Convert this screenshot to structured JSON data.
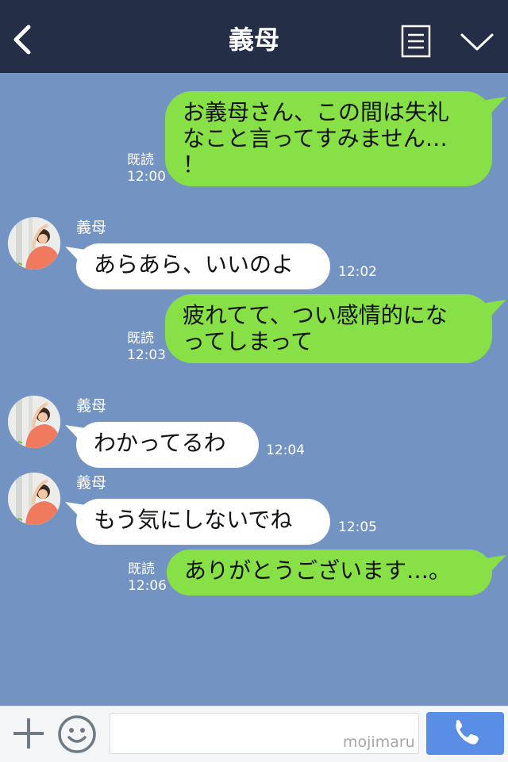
{
  "header": {
    "title": "義母",
    "background": "#242e46"
  },
  "colors": {
    "chat_background": "#7393c3",
    "outgoing_bubble": "#86e046",
    "incoming_bubble": "#ffffff",
    "call_button": "#5a8de6"
  },
  "messages": [
    {
      "direction": "out",
      "text": "お義母さん、この間は失礼\nなこと言ってすみません…\n！",
      "read_label": "既読",
      "time": "12:00"
    },
    {
      "direction": "in",
      "sender": "義母",
      "text": "あらあら、いいのよ",
      "time": "12:02"
    },
    {
      "direction": "out",
      "text": "疲れてて、つい感情的にな\nってしまって",
      "read_label": "既読",
      "time": "12:03"
    },
    {
      "direction": "in",
      "sender": "義母",
      "text": "わかってるわ",
      "time": "12:04"
    },
    {
      "direction": "in",
      "sender": "義母",
      "text": "もう気にしないでね",
      "time": "12:05"
    },
    {
      "direction": "out",
      "text": "ありがとうございます…。",
      "read_label": "既読",
      "time": "12:06"
    }
  ],
  "footer": {
    "input_value": "",
    "watermark": "mojimaru"
  },
  "icons": {
    "back": "chevron-left-icon",
    "menu": "document-list-icon",
    "collapse": "chevron-down-icon",
    "add": "plus-icon",
    "emoji": "smiley-icon",
    "call": "phone-icon"
  }
}
